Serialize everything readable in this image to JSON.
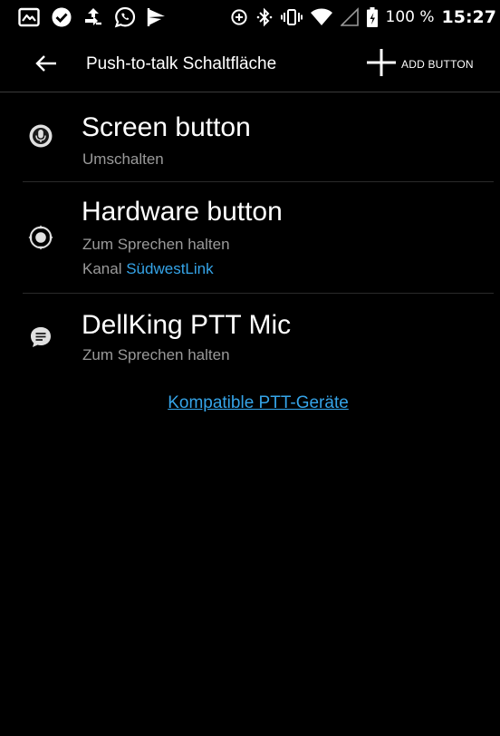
{
  "status_bar": {
    "left_icons": [
      "gallery-icon",
      "messaging-check-icon",
      "transfer-arrows-icon",
      "whatsapp-icon",
      "flag-icon"
    ],
    "right_icons": [
      "data-saver-icon",
      "bluetooth-icon",
      "vibrate-icon",
      "wifi-icon",
      "cell-signal-icon",
      "battery-icon"
    ],
    "battery_percent": "100 %",
    "time": "15:27"
  },
  "app_bar": {
    "back_icon": "arrow-back-icon",
    "title": "Push-to-talk Schaltfläche",
    "add_icon": "plus-icon",
    "add_label": "ADD BUTTON"
  },
  "items": [
    {
      "icon": "microphone-icon",
      "title": "Screen button",
      "subtitle": "Umschalten"
    },
    {
      "icon": "hardware-dpad-icon",
      "title": "Hardware button",
      "subtitle": "Zum Sprechen halten",
      "channel_prefix": "Kanal",
      "channel_name": "SüdwestLink"
    },
    {
      "icon": "message-icon",
      "title": "DellKing PTT Mic",
      "subtitle": "Zum Sprechen halten"
    }
  ],
  "footer_link": "Kompatible PTT-Geräte",
  "colors": {
    "background": "#000000",
    "text_primary": "#ffffff",
    "text_secondary": "#9a9a9a",
    "link": "#35a4e8",
    "divider": "#2a2a2a"
  }
}
